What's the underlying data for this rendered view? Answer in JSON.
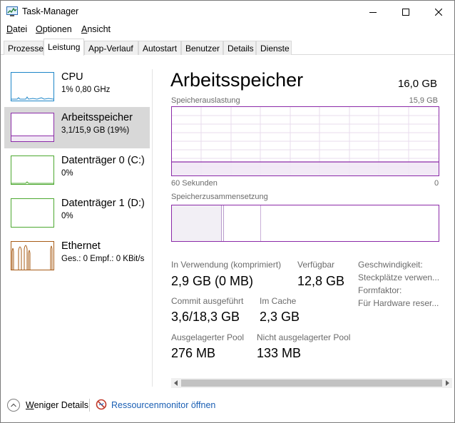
{
  "window": {
    "title": "Task-Manager"
  },
  "menu": [
    {
      "label": "Datei",
      "ul": "D",
      "rest": "atei"
    },
    {
      "label": "Optionen",
      "ul": "O",
      "rest": "ptionen"
    },
    {
      "label": "Ansicht",
      "ul": "A",
      "rest": "nsicht"
    }
  ],
  "tabs": [
    "Prozesse",
    "Leistung",
    "App-Verlauf",
    "Autostart",
    "Benutzer",
    "Details",
    "Dienste"
  ],
  "active_tab": "Leistung",
  "resources": [
    {
      "name": "CPU",
      "sub": "1% 0,80 GHz",
      "color": "#1e86c8"
    },
    {
      "name": "Arbeitsspeicher",
      "sub": "3,1/15,9 GB (19%)",
      "color": "#8b2aa8",
      "selected": true
    },
    {
      "name": "Datenträger 0 (C:)",
      "sub": "0%",
      "color": "#4da830"
    },
    {
      "name": "Datenträger 1 (D:)",
      "sub": "0%",
      "color": "#4da830"
    },
    {
      "name": "Ethernet",
      "sub": "Ges.: 0 Empf.: 0 KBit/s",
      "color": "#a75b16"
    }
  ],
  "detail": {
    "title": "Arbeitsspeicher",
    "total": "16,0 GB",
    "usage_label": "Speicherauslastung",
    "usage_max": "15,9 GB",
    "axis_left": "60 Sekunden",
    "axis_right": "0",
    "usage_level": 0.19,
    "composition_label": "Speicherzusammensetzung",
    "stats": {
      "in_use_label": "In Verwendung (komprimiert)",
      "in_use_value": "2,9 GB (0 MB)",
      "available_label": "Verfügbar",
      "available_value": "12,8 GB",
      "commit_label": "Commit ausgeführt",
      "commit_value": "3,6/18,3 GB",
      "cache_label": "Im Cache",
      "cache_value": "2,3 GB",
      "paged_label": "Ausgelagerter Pool",
      "paged_value": "276 MB",
      "nonpaged_label": "Nicht ausgelagerter Pool",
      "nonpaged_value": "133 MB"
    },
    "side": {
      "speed": "Geschwindigkeit:",
      "slots": "Steckplätze verwen...",
      "form": "Formfaktor:",
      "reserved": "Für Hardware reser..."
    }
  },
  "footer": {
    "fewer_details": "Weniger Details",
    "fewer_ul": "W",
    "fewer_rest": "eniger Details",
    "resmon": "Ressourcenmonitor öffnen"
  },
  "colors": {
    "memory": "#8b2aa8",
    "cpu": "#1e86c8",
    "disk": "#4da830",
    "ethernet": "#a75b16",
    "link": "#1a5fb4"
  }
}
